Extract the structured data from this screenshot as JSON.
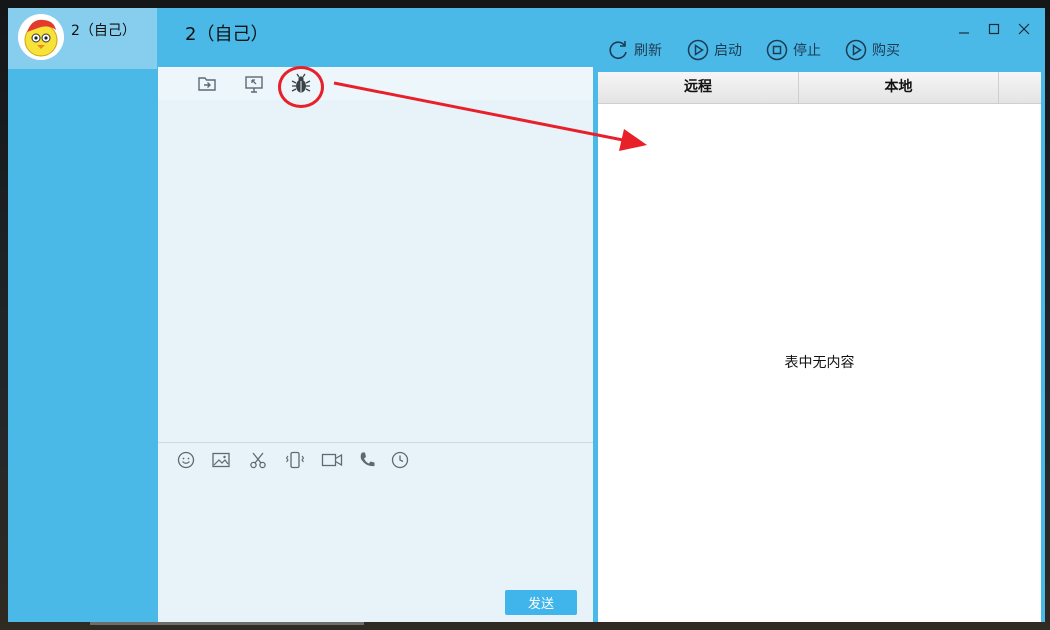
{
  "contact": {
    "name": "2（自己）"
  },
  "header": {
    "title": "2（自己）"
  },
  "window_controls": {
    "minimize": "minimize-icon",
    "maximize": "maximize-icon",
    "close": "close-icon"
  },
  "toolbar": {
    "refresh_label": "刷新",
    "start_label": "启动",
    "stop_label": "停止",
    "buy_label": "购买"
  },
  "chat_toolbar": {
    "icons": [
      "send-file-icon",
      "remote-desktop-icon",
      "bug-icon"
    ]
  },
  "input_toolbar": {
    "icons": [
      "emoji-icon",
      "image-icon",
      "screenshot-scissors-icon",
      "shake-icon",
      "video-call-icon",
      "voice-call-icon",
      "history-icon"
    ]
  },
  "send_button": {
    "label": "发送"
  },
  "file_table": {
    "columns": [
      "远程",
      "本地",
      ""
    ],
    "empty_message": "表中无内容"
  },
  "colors": {
    "accent": "#4ab9e8",
    "contact_selected": "#87cdee",
    "send_button": "#3fb5ec",
    "annotation": "#e8202a"
  }
}
